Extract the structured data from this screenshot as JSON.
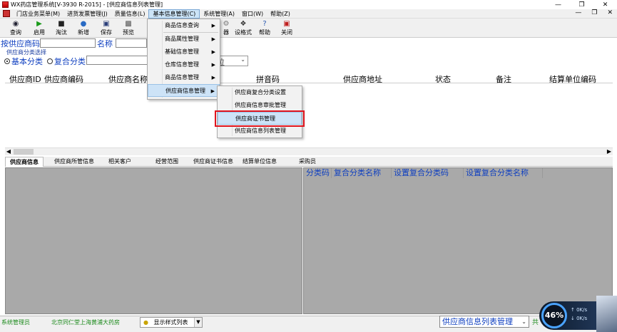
{
  "window": {
    "title": "WX药店管理系统[V-3930 R-2015] - [供应商信息列表管理]",
    "controls": [
      "—",
      "❐",
      "✕"
    ]
  },
  "menubar": {
    "items": [
      "门店业务菜单(M)",
      "进货发票管理(J)",
      "质量信息(L)",
      "基本信息管理(C)",
      "系统管理(A)",
      "窗口(W)",
      "帮助(Z)"
    ],
    "mdi_controls": [
      "—",
      "❐",
      "✕"
    ]
  },
  "toolbar": {
    "buttons": [
      {
        "label": "查询",
        "icon": "binoculars-icon"
      },
      {
        "label": "启用",
        "icon": "play-icon"
      },
      {
        "label": "淘汰",
        "icon": "stop-icon"
      },
      {
        "label": "新增",
        "icon": "globe-icon"
      },
      {
        "label": "保存",
        "icon": "save-icon"
      },
      {
        "label": "预览",
        "icon": "preview-icon"
      },
      {
        "label": "器",
        "icon": "tool-icon"
      },
      {
        "label": "设格式",
        "icon": "format-icon"
      },
      {
        "label": "帮助",
        "icon": "help-icon"
      },
      {
        "label": "关闭",
        "icon": "close-door-icon"
      }
    ]
  },
  "filters": {
    "supplier_code_label": "按供应商码",
    "name_label": "名称",
    "category_group_caption": "供应商分类选择",
    "radio_basic": "基本分类",
    "radio_composite": "复合分类",
    "unit_select_fragment": "位"
  },
  "grid": {
    "columns": [
      "供应商ID",
      "供应商编码",
      "供应商名称",
      "拼音码",
      "供应商地址",
      "状态",
      "备注",
      "结算单位编码"
    ]
  },
  "tabs": [
    "供应商信息",
    "供应商所管信息",
    "相关客户",
    "经营范围",
    "供应商证书信息",
    "结算单位信息",
    "采购员"
  ],
  "right_table": {
    "columns": [
      "分类码",
      "复合分类名称",
      "设置复合分类码",
      "设置复合分类名称"
    ]
  },
  "statusbar": {
    "user": "系统管理员",
    "store": "北京同仁堂上海黄浦大药房",
    "style_combo": "显示样式列表",
    "form_combo": "供应商信息列表管理",
    "edge_fragment": "共"
  },
  "widget": {
    "percent": "46%",
    "up": "0K/s",
    "down": "0K/s"
  },
  "menu_basic_info": {
    "items": [
      {
        "label": "商品信息查询",
        "has_sub": true
      },
      {
        "label": "商品属性管理",
        "has_sub": true
      },
      {
        "label": "基础信息管理",
        "has_sub": true
      },
      {
        "label": "仓库信息管理",
        "has_sub": true
      },
      {
        "label": "商品信息管理",
        "has_sub": true
      },
      {
        "label": "供应商信息管理",
        "has_sub": true
      }
    ]
  },
  "submenu_supplier": {
    "items": [
      "供应商复合分类设置",
      "供应商信息审批管理",
      "供应商证书管理",
      "供应商信息列表管理"
    ],
    "highlighted": "供应商证书管理"
  },
  "colors": {
    "accent_blue": "#1040c0",
    "highlight_red": "#e0141e",
    "panel_gray": "#a9a9a9",
    "menu_hot": "#cde3f7"
  }
}
